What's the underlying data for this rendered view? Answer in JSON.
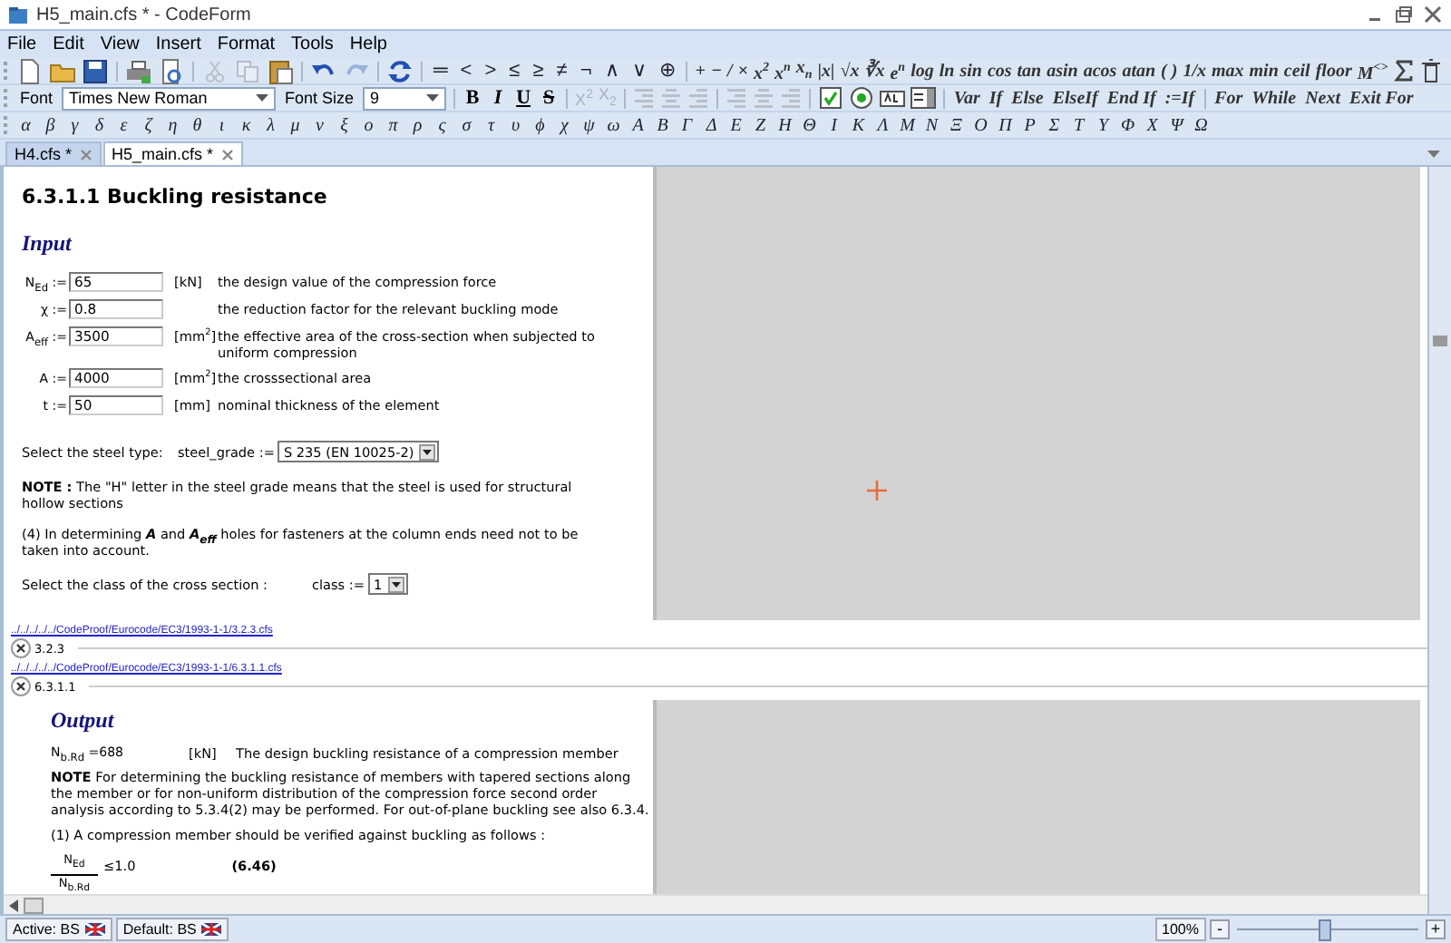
{
  "window": {
    "title": "H5_main.cfs * - CodeForm"
  },
  "menu": [
    "File",
    "Edit",
    "View",
    "Insert",
    "Format",
    "Tools",
    "Help"
  ],
  "file_tools": [
    {
      "kind": "new",
      "disabled": false
    },
    {
      "kind": "open",
      "disabled": false
    },
    {
      "kind": "save",
      "disabled": false
    },
    {
      "kind": "print",
      "disabled": false
    },
    {
      "kind": "preview",
      "disabled": false
    },
    {
      "kind": "cut",
      "disabled": true
    },
    {
      "kind": "copy",
      "disabled": true
    },
    {
      "kind": "paste",
      "disabled": false
    },
    {
      "kind": "undo",
      "disabled": false
    },
    {
      "kind": "redo",
      "disabled": true
    },
    {
      "kind": "refresh",
      "disabled": false
    }
  ],
  "operators": [
    "═",
    "<",
    ">",
    "≤",
    "≥",
    "≠",
    "¬",
    "∧",
    "∨",
    "⊕"
  ],
  "math_functions": [
    "+",
    "−",
    "/",
    "×",
    "x$^{2}$",
    "x$^{n}$",
    "x$_{n}$",
    "|x|",
    "√x",
    "∛x",
    "e$^{n}$",
    "log",
    "ln",
    "sin",
    "cos",
    "tan",
    "asin",
    "acos",
    "atan",
    "( )",
    "1/x",
    "max",
    "min",
    "ceil",
    "floor",
    "M$^{<>}$"
  ],
  "format_toolbar": {
    "font_label": "Font",
    "font": "Times New Roman",
    "size_label": "Font Size",
    "size": "9",
    "style_buttons": [
      {
        "label": "B",
        "kind": "bold"
      },
      {
        "label": "I",
        "kind": "italic"
      },
      {
        "label": "U",
        "kind": "underline"
      },
      {
        "label": "S",
        "kind": "strike"
      }
    ],
    "script_buttons": [
      {
        "label": "X$^{2}$",
        "disabled": true
      },
      {
        "label": "X$_{2}$",
        "disabled": true
      }
    ],
    "align_tools": [
      {
        "kind": "left",
        "disabled": true
      },
      {
        "kind": "center",
        "disabled": true
      },
      {
        "kind": "right",
        "disabled": true
      },
      {
        "kind": "left",
        "disabled": true
      },
      {
        "kind": "center",
        "disabled": true
      },
      {
        "kind": "right",
        "disabled": true
      }
    ],
    "control_tools": [
      {
        "kind": "checkbox"
      },
      {
        "kind": "radio"
      },
      {
        "kind": "textbox"
      },
      {
        "kind": "listbox"
      }
    ],
    "condition_words": [
      "Var",
      "If",
      "Else",
      "ElseIf",
      "End If",
      ":=If"
    ],
    "loop_words": [
      "For",
      "While",
      "Next",
      "Exit For"
    ]
  },
  "greek": [
    "α",
    "β",
    "γ",
    "δ",
    "ε",
    "ζ",
    "η",
    "θ",
    "ι",
    "κ",
    "λ",
    "μ",
    "ν",
    "ξ",
    "ο",
    "π",
    "ρ",
    "ς",
    "σ",
    "τ",
    "υ",
    "ϕ",
    "χ",
    "ψ",
    "ω",
    "Α",
    "Β",
    "Γ",
    "Δ",
    "Ε",
    "Ζ",
    "Η",
    "Θ",
    "Ι",
    "Κ",
    "Λ",
    "Μ",
    "Ν",
    "Ξ",
    "Ο",
    "Π",
    "Ρ",
    "Σ",
    "Τ",
    "Υ",
    "Φ",
    "Χ",
    "Ψ",
    "Ω"
  ],
  "tabs": [
    {
      "label": "H4.cfs *",
      "selected": false
    },
    {
      "label": "H5_main.cfs *",
      "selected": true
    }
  ],
  "document": {
    "heading": "6.3.1.1 Buckling resistance",
    "input_title": "Input",
    "inputs": [
      {
        "symbol": "N$_{Ed}$",
        "op": ":=",
        "value": "65",
        "unit": "[kN]",
        "description": "the design value of the compression force"
      },
      {
        "symbol": "χ",
        "op": ":=",
        "value": "0.8",
        "description": "the reduction factor for the relevant buckling mode"
      },
      {
        "symbol": "A$_{eff}$",
        "op": ":=",
        "value": "3500",
        "unit": "[mm$^{2}$]",
        "description": "the effective area of the cross-section when subjected to uniform compression"
      },
      {
        "symbol": "A",
        "op": ":=",
        "value": "4000",
        "unit": "[mm$^{2}$]",
        "description": "the crosssectional area"
      },
      {
        "symbol": "t",
        "op": ":=",
        "value": "50",
        "unit": "[mm]",
        "description": "nominal thickness of the element"
      }
    ],
    "steel_select": {
      "label": "Select the steel type:",
      "variable": "steel_grade :=",
      "value": "S 235 (EN 10025-2)"
    },
    "note": "**NOTE :** The \"H\" letter in the steel grade means that the steel is used for structural hollow sections",
    "paragraph": "(4) In determining **A** and **A$_{eff}$** holes for fasteners at the column ends need not to be taken into account.",
    "class_select": {
      "label": "Select the class of the cross section :",
      "variable": "class :=",
      "value": "1"
    }
  },
  "links": [
    {
      "path": "../../../../../CodeProof/Eurocode/EC3/1993-1-1/3.2.3.cfs",
      "section": "3.2.3"
    },
    {
      "path": "../../../../../CodeProof/Eurocode/EC3/1993-1-1/6.3.1.1.cfs",
      "section": "6.3.1.1"
    }
  ],
  "output": {
    "title": "Output",
    "result": "N$_{b.Rd}$ =688",
    "unit": "[kN]",
    "description": "The design buckling resistance of a compression member",
    "note": "**NOTE** For determining the buckling resistance of members with tapered sections along the member or for non-uniform distribution of the compression force second order analysis according to 5.3.4(2) may be performed. For out-of-plane buckling see also 6.3.4.",
    "paragraph": "(1) A compression member should be verified against buckling as follows :",
    "formula": {
      "numerator": "N$_{Ed}$",
      "denominator": "N$_{b.Rd}$",
      "relation": "≤1.0",
      "number": "(6.46)"
    }
  },
  "status": {
    "active": "Active: BS",
    "default": "Default: BS",
    "zoom": "100%",
    "zoom_out": "-",
    "zoom_in": "+",
    "zoom_slider": {
      "level": 0.48
    }
  }
}
